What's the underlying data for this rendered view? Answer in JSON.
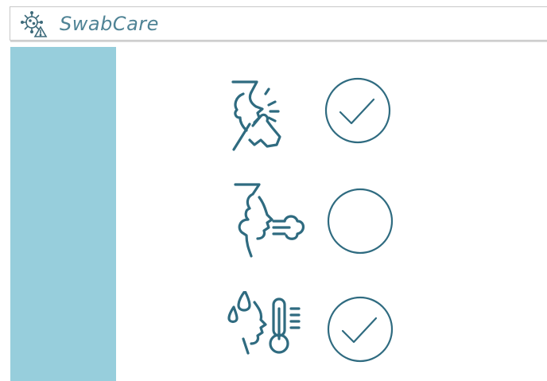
{
  "app": {
    "title": "SwabCare",
    "logo_icon": "virus-warning-icon"
  },
  "colors": {
    "accent": "#2f6b80",
    "title": "#4f8395",
    "sidebar": "#97cedc",
    "background": "#ffffff"
  },
  "symptoms": [
    {
      "icon": "cough-icon",
      "checked": true
    },
    {
      "icon": "breath-icon",
      "checked": false
    },
    {
      "icon": "fever-icon",
      "checked": true
    }
  ]
}
